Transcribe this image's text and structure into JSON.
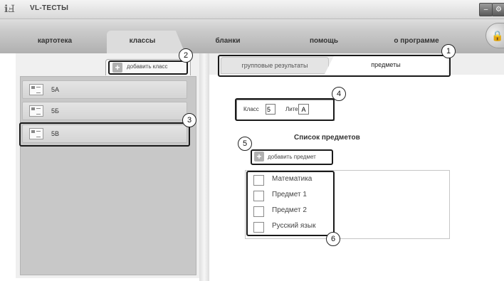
{
  "app": {
    "logo": "ℹℲ",
    "title": "VL-ТЕСТЫ"
  },
  "window": {
    "minimize_glyph": "‒",
    "settings_glyph": "⚙"
  },
  "menu": {
    "items": [
      {
        "label": "картотека"
      },
      {
        "label": "классы"
      },
      {
        "label": "бланки"
      },
      {
        "label": "помощь"
      },
      {
        "label": "о программе"
      }
    ],
    "active": "классы",
    "lock_glyph": "🔒"
  },
  "left": {
    "add_class_label": "добавить класс",
    "plus_glyph": "+",
    "classes": [
      {
        "label": "5А"
      },
      {
        "label": "5Б"
      },
      {
        "label": "5В"
      }
    ]
  },
  "right": {
    "tabs": [
      {
        "label": "групповые результаты"
      },
      {
        "label": "предметы"
      }
    ],
    "class_label": "Класс",
    "class_value": "5",
    "liter_label": "Литер",
    "liter_value": "А",
    "subjects_title": "Список предметов",
    "add_subject_label": "добавить предмет",
    "subjects": [
      {
        "label": "Математика",
        "checked": false
      },
      {
        "label": "Предмет 1",
        "checked": false
      },
      {
        "label": "Предмет 2",
        "checked": false
      },
      {
        "label": "Русский язык",
        "checked": false
      }
    ]
  },
  "callouts": [
    "1",
    "2",
    "3",
    "4",
    "5",
    "6"
  ]
}
